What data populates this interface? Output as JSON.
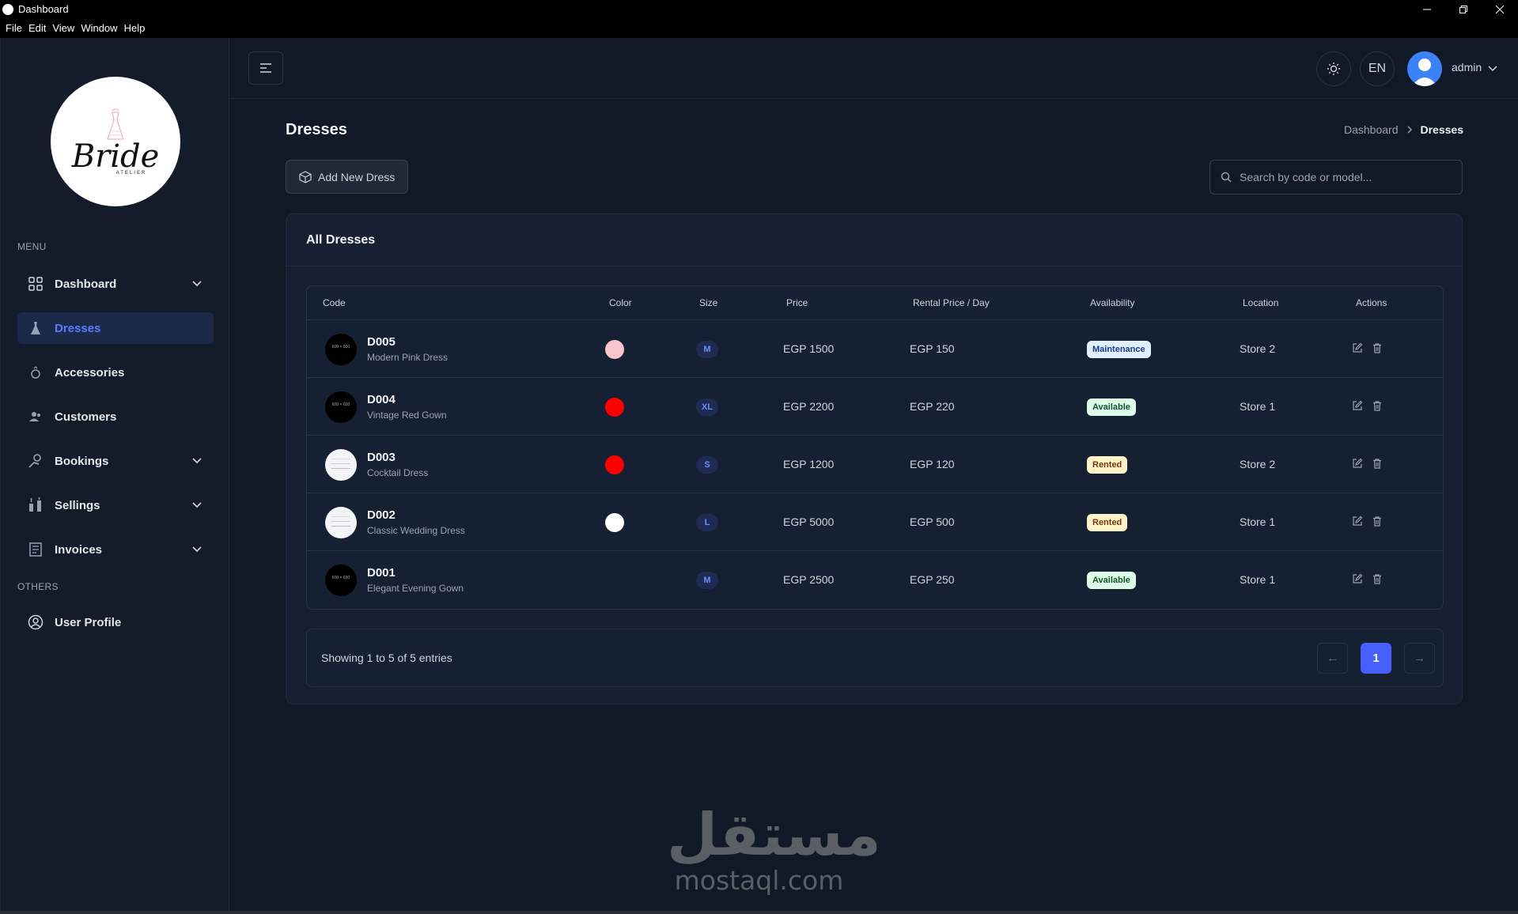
{
  "window": {
    "title": "Dashboard",
    "menus": [
      "File",
      "Edit",
      "View",
      "Window",
      "Help"
    ]
  },
  "sidebar": {
    "logo_text": "Bride",
    "logo_sub": "ATELIER",
    "menu_label": "MENU",
    "others_label": "OTHERS",
    "items": [
      {
        "label": "Dashboard",
        "icon": "grid-icon",
        "has_children": true,
        "active": false
      },
      {
        "label": "Dresses",
        "icon": "dress-icon",
        "has_children": false,
        "active": true
      },
      {
        "label": "Accessories",
        "icon": "ring-icon",
        "has_children": false,
        "active": false
      },
      {
        "label": "Customers",
        "icon": "users-icon",
        "has_children": false,
        "active": false
      },
      {
        "label": "Bookings",
        "icon": "booking-icon",
        "has_children": true,
        "active": false
      },
      {
        "label": "Sellings",
        "icon": "sellings-icon",
        "has_children": true,
        "active": false
      },
      {
        "label": "Invoices",
        "icon": "invoice-icon",
        "has_children": true,
        "active": false
      }
    ],
    "other_items": [
      {
        "label": "User Profile",
        "icon": "user-circle-icon"
      }
    ]
  },
  "header": {
    "lang": "EN",
    "user": "admin"
  },
  "page": {
    "title": "Dresses",
    "breadcrumb": {
      "parent": "Dashboard",
      "current": "Dresses"
    },
    "add_button": "Add New Dress",
    "search_placeholder": "Search by code or model..."
  },
  "table": {
    "title": "All Dresses",
    "columns": [
      "Code",
      "Color",
      "Size",
      "Price",
      "Rental Price / Day",
      "Availability",
      "Location",
      "Actions"
    ],
    "rows": [
      {
        "code": "D005",
        "model": "Modern Pink Dress",
        "thumb": "dark",
        "color": "#f6c6cc",
        "size": "M",
        "price": "EGP 1500",
        "rental": "EGP 150",
        "status": "Maintenance",
        "location": "Store 2"
      },
      {
        "code": "D004",
        "model": "Vintage Red Gown",
        "thumb": "dark",
        "color": "#ff0000",
        "size": "XL",
        "price": "EGP 2200",
        "rental": "EGP 220",
        "status": "Available",
        "location": "Store 1"
      },
      {
        "code": "D003",
        "model": "Cocktail Dress",
        "thumb": "light",
        "color": "#ff0000",
        "size": "S",
        "price": "EGP 1200",
        "rental": "EGP 120",
        "status": "Rented",
        "location": "Store 2"
      },
      {
        "code": "D002",
        "model": "Classic Wedding Dress",
        "thumb": "light",
        "color": "#ffffff",
        "size": "L",
        "price": "EGP 5000",
        "rental": "EGP 500",
        "status": "Rented",
        "location": "Store 1"
      },
      {
        "code": "D001",
        "model": "Elegant Evening Gown",
        "thumb": "dark",
        "color": "",
        "size": "M",
        "price": "EGP 2500",
        "rental": "EGP 250",
        "status": "Available",
        "location": "Store 1"
      }
    ],
    "showing": "Showing 1 to 5 of 5 entries",
    "pagination": {
      "prev": "←",
      "current": "1",
      "next": "→"
    }
  },
  "status_colors": {
    "Maintenance": {
      "bg": "#e0f0ff",
      "fg": "#1e3a8a"
    },
    "Available": {
      "bg": "#dcfce7",
      "fg": "#14532d"
    },
    "Rented": {
      "bg": "#fef3c7",
      "fg": "#78350f"
    }
  },
  "watermark": {
    "arabic": "مستقل",
    "latin": "mostaql.com"
  },
  "colors": {
    "accent": "#465fff",
    "background": "#111827",
    "sidebar": "#141b2b"
  }
}
